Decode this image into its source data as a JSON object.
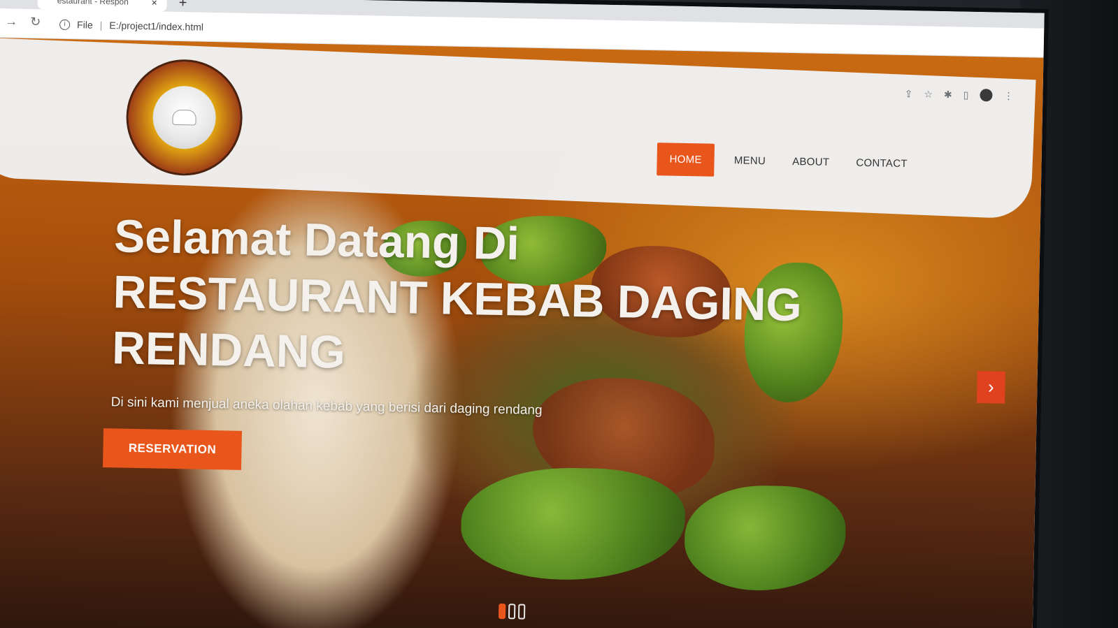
{
  "browser": {
    "tab_title": "estaurant - Respon",
    "tab_close": "×",
    "new_tab": "+",
    "back": "→",
    "reload": "↻",
    "address_scheme": "File",
    "address_path": "E:/project1/index.html",
    "icons": [
      "share-icon",
      "star-icon",
      "extensions-icon",
      "sidepanel-icon",
      "profile-icon",
      "kebab-menu-icon"
    ]
  },
  "site": {
    "nav": [
      "HOME",
      "MENU",
      "ABOUT",
      "CONTACT"
    ],
    "active_nav": "HOME",
    "hero_title_line1": "Selamat Datang Di",
    "hero_title_line2": "RESTAURANT KEBAB DAGING RENDANG",
    "hero_subtitle": "Di sini kami menjual aneka olahan kebab yang berisi dari daging rendang",
    "cta_label": "RESERVATION",
    "next_label": "›",
    "accent_color": "#e8561c"
  }
}
